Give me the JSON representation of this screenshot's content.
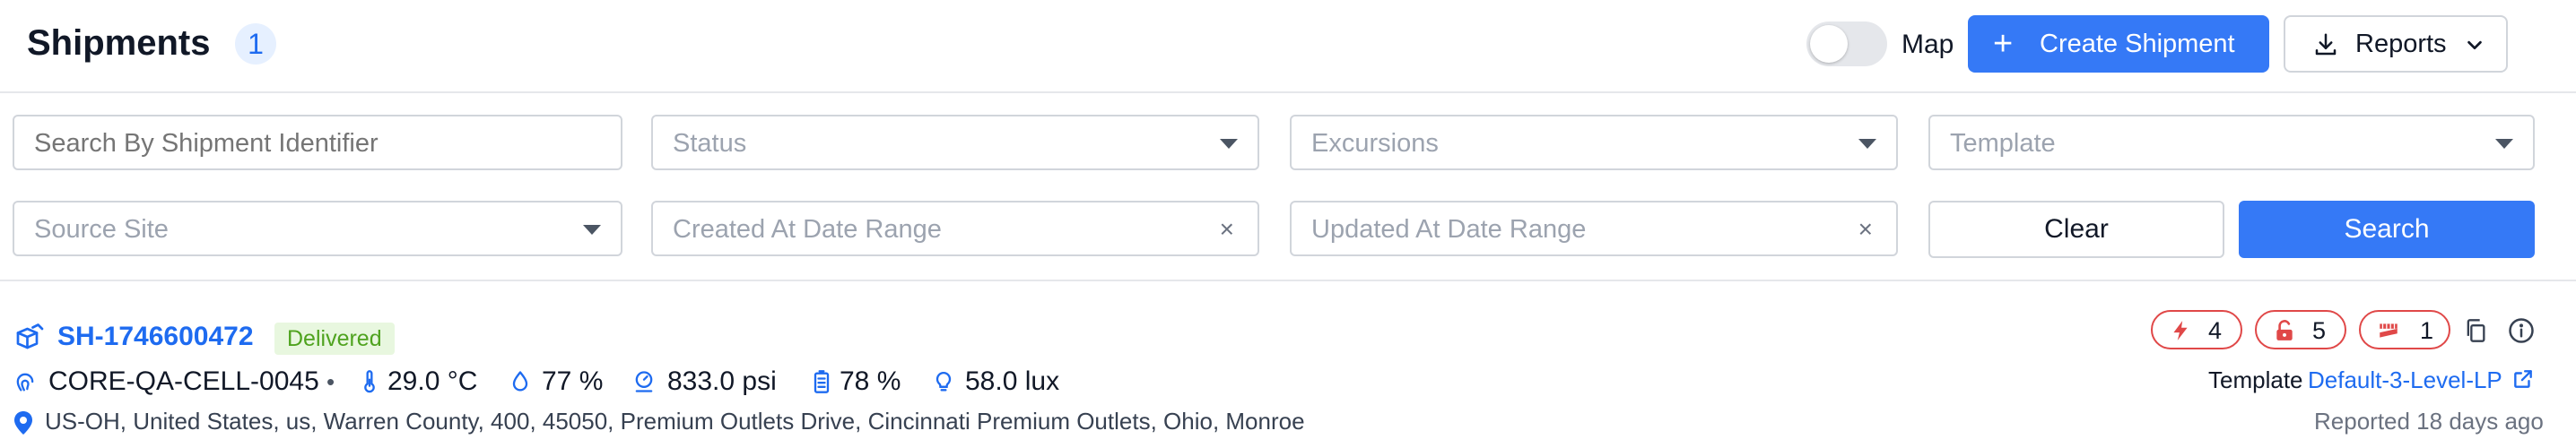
{
  "header": {
    "title": "Shipments",
    "count": "1",
    "map_label": "Map",
    "map_toggle_on": false,
    "create_button": "Create Shipment",
    "reports_button": "Reports"
  },
  "filters": {
    "search_placeholder": "Search By Shipment Identifier",
    "status_placeholder": "Status",
    "excursions_placeholder": "Excursions",
    "template_placeholder": "Template",
    "source_site_placeholder": "Source Site",
    "created_range_placeholder": "Created At Date Range",
    "updated_range_placeholder": "Updated At Date Range",
    "clear_button": "Clear",
    "search_button": "Search"
  },
  "shipment": {
    "id": "SH-1746600472",
    "status": "Delivered",
    "device": "CORE-QA-CELL-0045",
    "temperature": "29.0 °C",
    "humidity": "77 %",
    "pressure": "833.0 psi",
    "battery": "78 %",
    "light": "58.0 lux",
    "address": "US-OH, United States, us, Warren County, 400, 45050, Premium Outlets Drive, Cincinnati Premium Outlets, Ohio, Monroe",
    "alerts": {
      "shock": "4",
      "unlock": "5",
      "tamper": "1"
    },
    "template_label": "Template",
    "template_name": "Default-3-Level-LP",
    "reported": "Reported 18 days ago"
  },
  "colors": {
    "primary": "#3579f6",
    "link": "#1e6bf0",
    "alert": "#e04848",
    "success_bg": "#e8f7df",
    "success_text": "#4fa31f"
  }
}
